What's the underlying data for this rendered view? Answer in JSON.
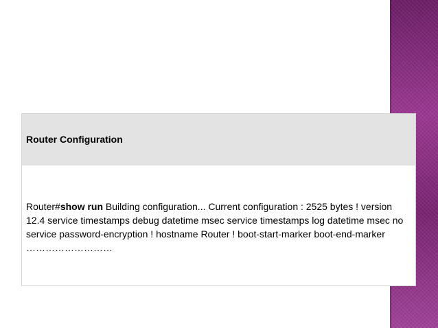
{
  "table": {
    "header": "Router Configuration",
    "body": {
      "prompt": "Router#",
      "command": "show run",
      "output": " Building configuration... Current configuration : 2525 bytes ! version 12.4 service timestamps debug datetime msec service timestamps log datetime msec no service password-encryption ! hostname Router ! boot-start-marker boot-end-marker ………………………"
    }
  },
  "colors": {
    "accent_band": "#8e2f86",
    "header_background": "#e3e3e3"
  }
}
